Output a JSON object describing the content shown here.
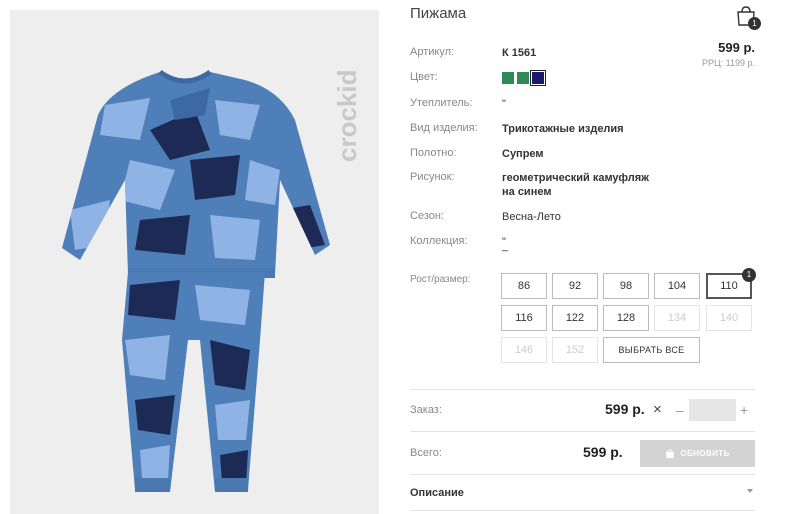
{
  "product": {
    "title": "Пижама",
    "image_alt": "pajama-photo",
    "brand_logo_text": "crockid"
  },
  "cart": {
    "count": "1"
  },
  "attributes": [
    {
      "label": "Артикул:",
      "value": "К 1561"
    },
    {
      "label": "Цвет:",
      "value": ""
    },
    {
      "label": "Утеплитель:",
      "value": "\""
    },
    {
      "label": "Вид изделия:",
      "value": "Трикотажные изделия"
    },
    {
      "label": "Полотно:",
      "value": "Супрем"
    },
    {
      "label": "Рисунок:",
      "value": "геометрический камуфляж",
      "value2": "на синем"
    },
    {
      "label": "Сезон:",
      "value": "Весна-Лето"
    },
    {
      "label": "Коллекция:",
      "value": "\"",
      "value2": "_"
    }
  ],
  "price": {
    "current": "599 р.",
    "rrp": "РРЦ: 1199 р."
  },
  "colors": [
    {
      "name": "green",
      "hex": "#2e8b57",
      "selected": false
    },
    {
      "name": "green",
      "hex": "#2e8b57",
      "selected": false
    },
    {
      "name": "navy",
      "hex": "#1a1a6e",
      "selected": true
    }
  ],
  "sizes": {
    "label": "Рост/размер:",
    "items": [
      {
        "label": "86",
        "state": "available"
      },
      {
        "label": "92",
        "state": "available"
      },
      {
        "label": "98",
        "state": "available"
      },
      {
        "label": "104",
        "state": "available"
      },
      {
        "label": "110",
        "state": "selected",
        "badge": "1"
      },
      {
        "label": "116",
        "state": "available"
      },
      {
        "label": "122",
        "state": "available"
      },
      {
        "label": "128",
        "state": "available"
      },
      {
        "label": "134",
        "state": "disabled"
      },
      {
        "label": "140",
        "state": "disabled"
      },
      {
        "label": "146",
        "state": "disabled"
      },
      {
        "label": "152",
        "state": "disabled"
      }
    ],
    "select_all": "ВЫБРАТЬ ВСЕ"
  },
  "order": {
    "label": "Заказ:",
    "price": "599 р.",
    "times": "×",
    "minus": "–",
    "plus": "+",
    "quantity": ""
  },
  "total": {
    "label": "Всего:",
    "price": "599 р.",
    "update_button": "ОБНОВИТЬ"
  },
  "description": {
    "label": "Описание"
  },
  "style": {
    "pajama_base": "#4f7fb8",
    "camo_light": "#8fb3e4",
    "camo_dark": "#1d2a55",
    "camo_mid": "#3c68a3"
  }
}
